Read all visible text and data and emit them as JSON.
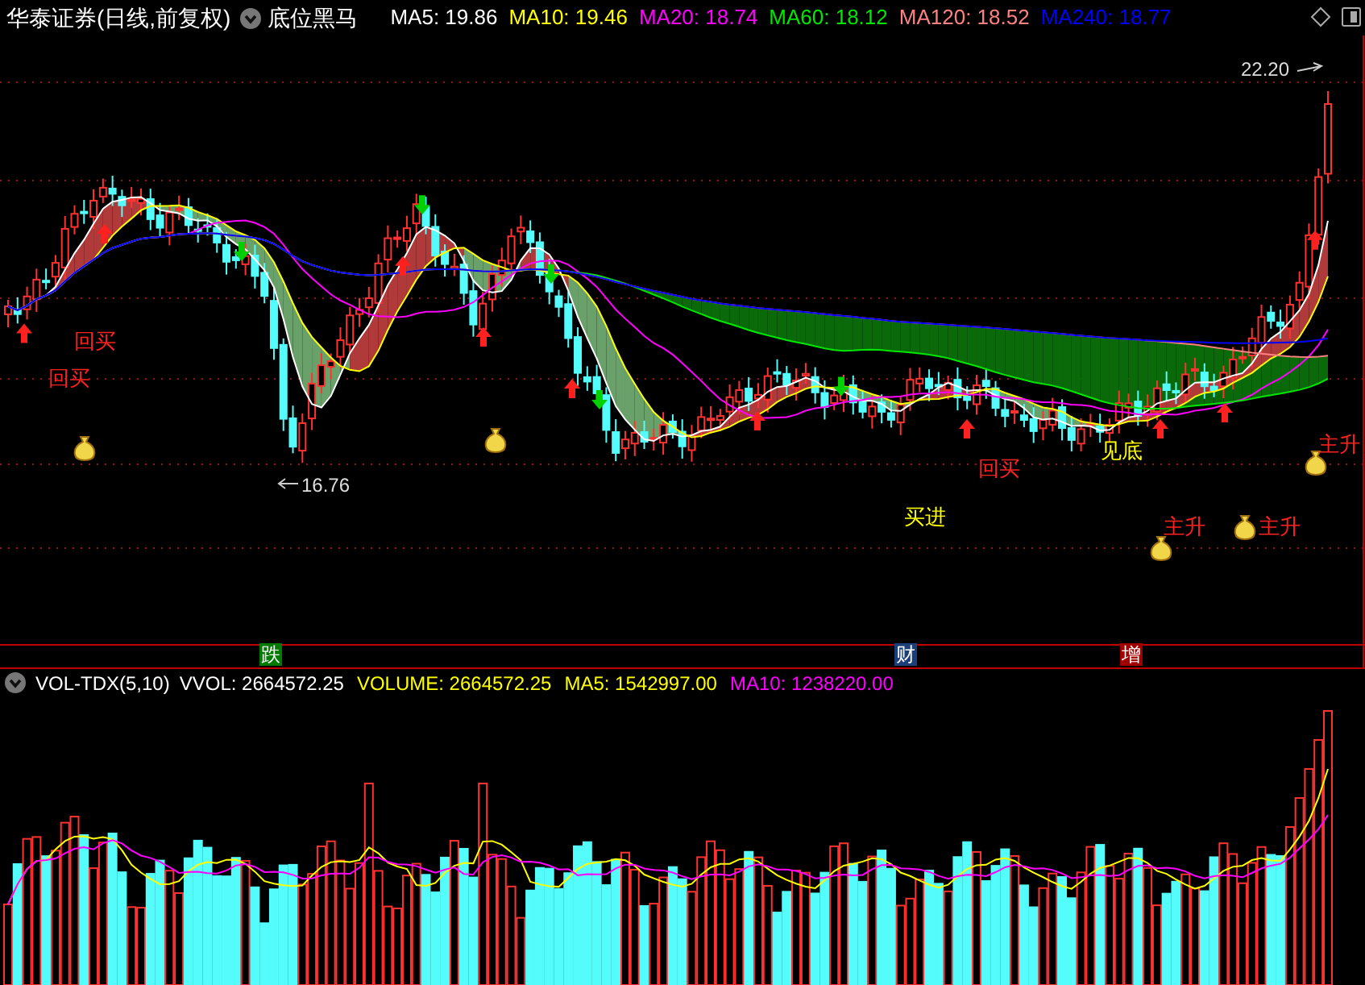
{
  "header": {
    "stock": "华泰证券(日线,前复权)",
    "formula": "底位黑马",
    "indicators": [
      {
        "label": "MA5: 19.86",
        "color": "#ffffff"
      },
      {
        "label": "MA10: 19.46",
        "color": "#ffff00"
      },
      {
        "label": "MA20: 18.74",
        "color": "#ff00ff"
      },
      {
        "label": "MA60: 18.12",
        "color": "#00e600"
      },
      {
        "label": "MA120: 18.52",
        "color": "#ff8080"
      },
      {
        "label": "MA240: 18.77",
        "color": "#0000ff"
      }
    ]
  },
  "price_chart": {
    "high_label": "22.20",
    "low_label": "16.76",
    "signals": [
      {
        "text": "回买",
        "color": "#ff2020"
      },
      {
        "text": "回买",
        "color": "#ff2020"
      },
      {
        "text": "回买",
        "color": "#ff2020"
      },
      {
        "text": "见底",
        "color": "#ffff00"
      },
      {
        "text": "买进",
        "color": "#ffff00"
      },
      {
        "text": "主升",
        "color": "#ff2020"
      },
      {
        "text": "主升",
        "color": "#ff2020"
      },
      {
        "text": "主升",
        "color": "#ff2020"
      }
    ]
  },
  "event_markers": [
    {
      "text": "跌",
      "color": "#007a00"
    },
    {
      "text": "财",
      "color": "#1c3f7a"
    },
    {
      "text": "增",
      "color": "#a00000"
    }
  ],
  "volume_panel": {
    "title": "VOL-TDX(5,10)",
    "indicators": [
      {
        "label": "VVOL: 2664572.25",
        "color": "#ffffff"
      },
      {
        "label": "VOLUME: 2664572.25",
        "color": "#ffff00"
      },
      {
        "label": "MA5: 1542997.00",
        "color": "#ffff00"
      },
      {
        "label": "MA10: 1238220.00",
        "color": "#ff00ff"
      }
    ]
  }
}
